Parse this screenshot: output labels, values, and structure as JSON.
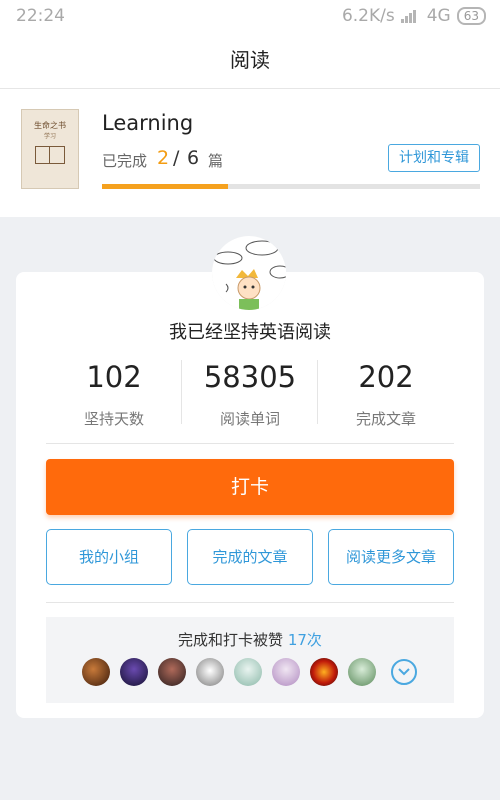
{
  "status_bar": {
    "time": "22:24",
    "network_speed": "6.2K/s",
    "network_type": "4G",
    "battery": "63"
  },
  "header": {
    "title": "阅读"
  },
  "book": {
    "title": "Learning",
    "cover_icon": "book-cover-icon",
    "progress_label": "已完成",
    "completed": "2",
    "separator": "/",
    "total": "6",
    "unit": "篇",
    "progress_fraction": 0.333,
    "plan_button": "计划和专辑"
  },
  "stats": {
    "headline": "我已经坚持英语阅读",
    "items": [
      {
        "value": "102",
        "label": "坚持天数"
      },
      {
        "value": "58305",
        "label": "阅读单词"
      },
      {
        "value": "202",
        "label": "完成文章"
      }
    ]
  },
  "actions": {
    "checkin": "打卡",
    "buttons": [
      "我的小组",
      "完成的文章",
      "阅读更多文章"
    ]
  },
  "likes": {
    "text": "完成和打卡被赞",
    "count": "17次",
    "avatars": [
      "avatar-1",
      "avatar-2",
      "avatar-3",
      "avatar-4",
      "avatar-5",
      "avatar-6",
      "avatar-7",
      "avatar-8"
    ],
    "expand_icon": "chevron-down-icon"
  },
  "colors": {
    "accent_orange": "#ff6a0c",
    "progress_orange": "#f5a11e",
    "link_blue": "#2f97d8"
  }
}
